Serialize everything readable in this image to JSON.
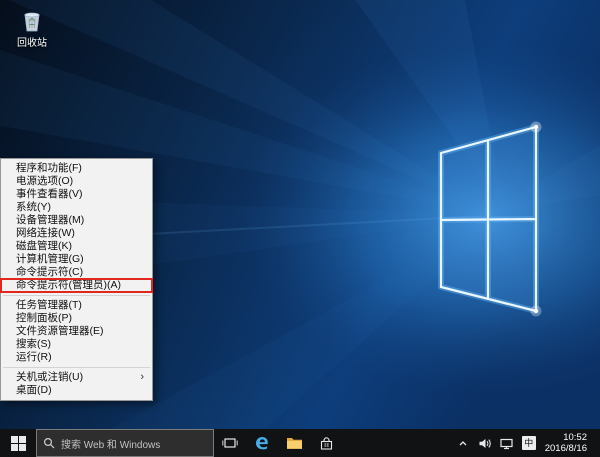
{
  "desktop": {
    "recycle_bin_label": "回收站"
  },
  "context_menu": {
    "items": [
      {
        "label": "程序和功能(F)"
      },
      {
        "label": "电源选项(O)"
      },
      {
        "label": "事件查看器(V)"
      },
      {
        "label": "系统(Y)"
      },
      {
        "label": "设备管理器(M)"
      },
      {
        "label": "网络连接(W)"
      },
      {
        "label": "磁盘管理(K)"
      },
      {
        "label": "计算机管理(G)"
      },
      {
        "label": "命令提示符(C)"
      },
      {
        "label": "命令提示符(管理员)(A)"
      },
      {
        "label": "任务管理器(T)"
      },
      {
        "label": "控制面板(P)"
      },
      {
        "label": "文件资源管理器(E)"
      },
      {
        "label": "搜索(S)"
      },
      {
        "label": "运行(R)"
      },
      {
        "label": "关机或注销(U)",
        "submenu_arrow": "›"
      },
      {
        "label": "桌面(D)"
      }
    ]
  },
  "taskbar": {
    "search_placeholder": "搜索 Web 和 Windows",
    "tray": {
      "ime_label": "中",
      "time": "10:52",
      "date": "2016/8/16"
    }
  },
  "colors": {
    "annotation_red": "#e0281e",
    "taskbar_bg": "#101214",
    "accent_blue": "#2f8be0"
  }
}
